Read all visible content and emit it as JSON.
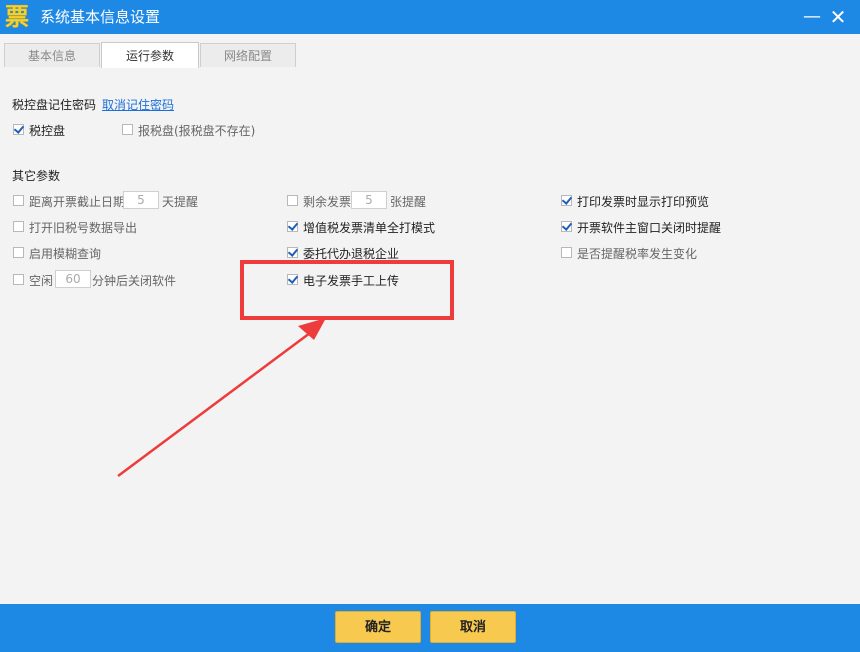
{
  "window": {
    "title": "系统基本信息设置",
    "app_icon_glyph": "票",
    "minimize_glyph": "—",
    "close_glyph": "✕"
  },
  "tabs": [
    {
      "label": "基本信息",
      "active": false
    },
    {
      "label": "运行参数",
      "active": true
    },
    {
      "label": "网络配置",
      "active": false
    }
  ],
  "tax_disk_section": {
    "title": "税控盘记住密码",
    "cancel_link": "取消记住密码",
    "options": [
      {
        "label": "税控盘",
        "checked": true
      },
      {
        "label": "报税盘(报税盘不存在)",
        "checked": false
      }
    ]
  },
  "other_params": {
    "title": "其它参数",
    "deadline": {
      "prefix": "距离开票截止日期",
      "value": "5",
      "suffix": "天提醒",
      "checked": false
    },
    "remaining": {
      "prefix": "剩余发票",
      "value": "5",
      "suffix": "张提醒",
      "checked": false
    },
    "print_preview": {
      "label": "打印发票时显示打印预览",
      "checked": true
    },
    "export_old": {
      "label": "打开旧税号数据导出",
      "checked": false
    },
    "vat_list_print": {
      "label": "增值税发票清单全打模式",
      "checked": true
    },
    "close_reminder": {
      "label": "开票软件主窗口关闭时提醒",
      "checked": true
    },
    "fuzzy_query": {
      "label": "启用模糊查询",
      "checked": false
    },
    "agent_refund": {
      "label": "委托代办退税企业",
      "checked": true
    },
    "tax_rate_change": {
      "label": "是否提醒税率发生变化",
      "checked": false
    },
    "idle": {
      "prefix": "空闲",
      "value": "60",
      "suffix": "分钟后关闭软件",
      "checked": false
    },
    "e_invoice_upload": {
      "label": "电子发票手工上传",
      "checked": true
    }
  },
  "footer": {
    "ok_label": "确定",
    "cancel_label": "取消"
  },
  "colors": {
    "accent": "#1e88e5",
    "button": "#f8c94f",
    "annotation": "#ee3b3b"
  }
}
